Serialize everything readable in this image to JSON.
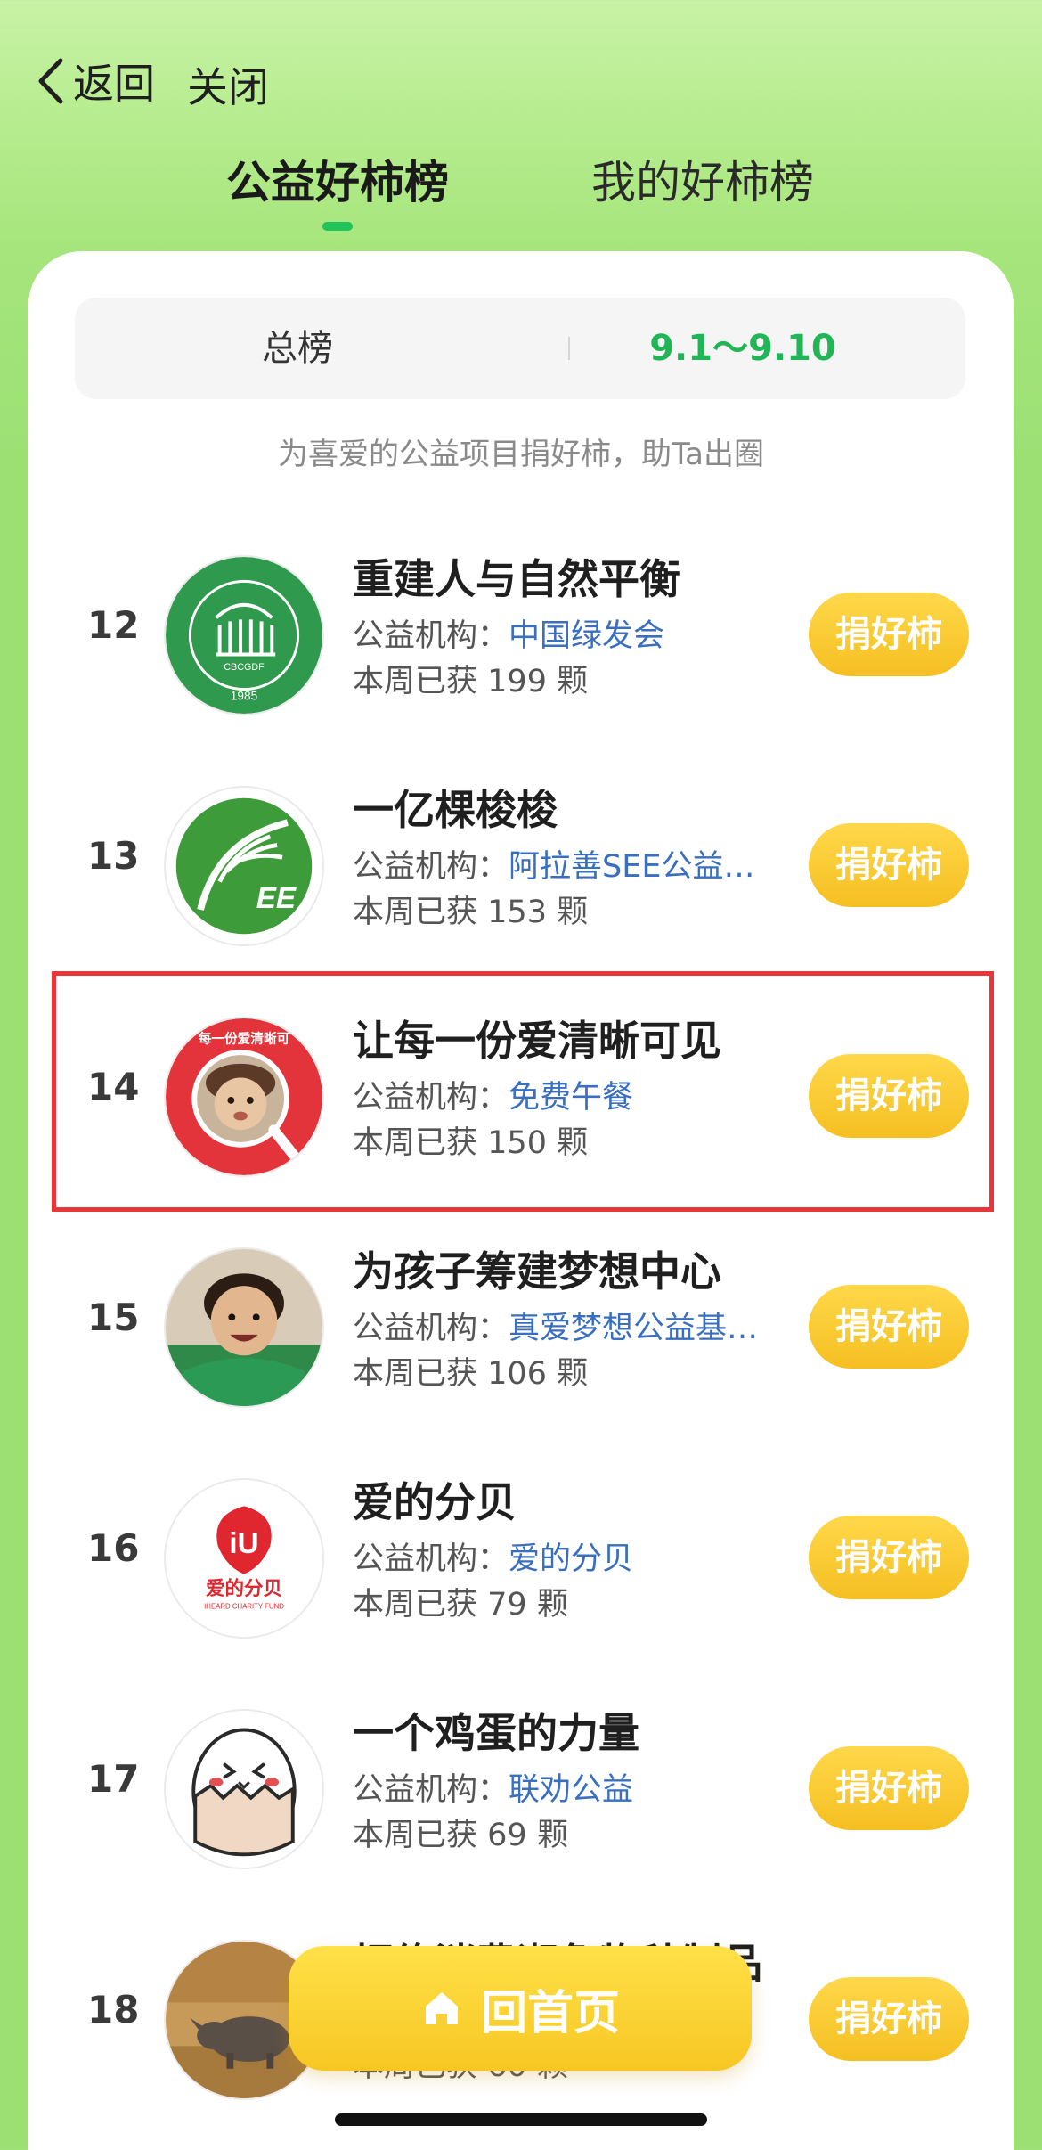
{
  "nav": {
    "back_label": "返回",
    "close_label": "关闭"
  },
  "tabs": [
    {
      "label": "公益好柿榜",
      "active": true
    },
    {
      "label": "我的好柿榜",
      "active": false
    }
  ],
  "filter": {
    "left": "总榜",
    "right": "9.1～9.10"
  },
  "tagline": "为喜爱的公益项目捐好柿，助Ta出圈",
  "org_prefix": "公益机构：",
  "week_prefix": "本周已获",
  "unit": "颗",
  "button_label": "捐好柿",
  "items": [
    {
      "rank": "12",
      "title": "重建人与自然平衡",
      "org": "中国绿发会",
      "count": "199",
      "avatar_icon": "cbcgdf-logo-icon",
      "avatar_text": "CBCGDF",
      "avatar_year": "1985"
    },
    {
      "rank": "13",
      "title": "一亿棵梭梭",
      "org": "阿拉善SEE公益…",
      "count": "153",
      "avatar_icon": "see-logo-icon",
      "avatar_text": "EE"
    },
    {
      "rank": "14",
      "title": "让每一份爱清晰可见",
      "org": "免费午餐",
      "count": "150",
      "avatar_icon": "free-lunch-child-icon",
      "avatar_text": "每一份爱清晰可"
    },
    {
      "rank": "15",
      "title": "为孩子筹建梦想中心",
      "org": "真爱梦想公益基…",
      "count": "106",
      "avatar_icon": "smiling-child-photo-icon"
    },
    {
      "rank": "16",
      "title": "爱的分贝",
      "org": "爱的分贝",
      "count": "79",
      "avatar_icon": "iheard-logo-icon",
      "avatar_text": "爱的分贝",
      "avatar_sub": "IHEARD CHARITY FUND"
    },
    {
      "rank": "17",
      "title": "一个鸡蛋的力量",
      "org": "联劝公益",
      "count": "69",
      "avatar_icon": "egg-mascot-icon"
    },
    {
      "rank": "18",
      "title": "拒绝消费濒危物种制品",
      "org": "",
      "count": "60",
      "avatar_icon": "rhino-photo-icon"
    }
  ],
  "home_button": "回首页",
  "colors": {
    "accent_green": "#21b555",
    "button_yellow": "#f5bf22",
    "org_blue": "#3a6fbf",
    "highlight_red": "#e8373b"
  }
}
